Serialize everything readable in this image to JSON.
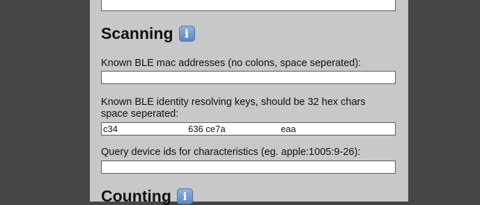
{
  "sections": {
    "scanning": {
      "title": "Scanning",
      "info_icon": "information-icon",
      "fields": [
        {
          "label": "Known BLE mac addresses (no colons, space seperated):",
          "value": ""
        },
        {
          "label": "Known BLE identity resolving keys, should be 32 hex chars space seperated:",
          "value": "c34                            636 ce7a                      eaa"
        },
        {
          "label": "Query device ids for characteristics (eg. apple:1005:9-26):",
          "value": ""
        }
      ]
    },
    "counting": {
      "title": "Counting",
      "info_icon": "information-icon"
    }
  },
  "colors": {
    "page_background": "#464646",
    "panel_background": "#c8c8c8",
    "info_icon": "#6a93cf"
  }
}
